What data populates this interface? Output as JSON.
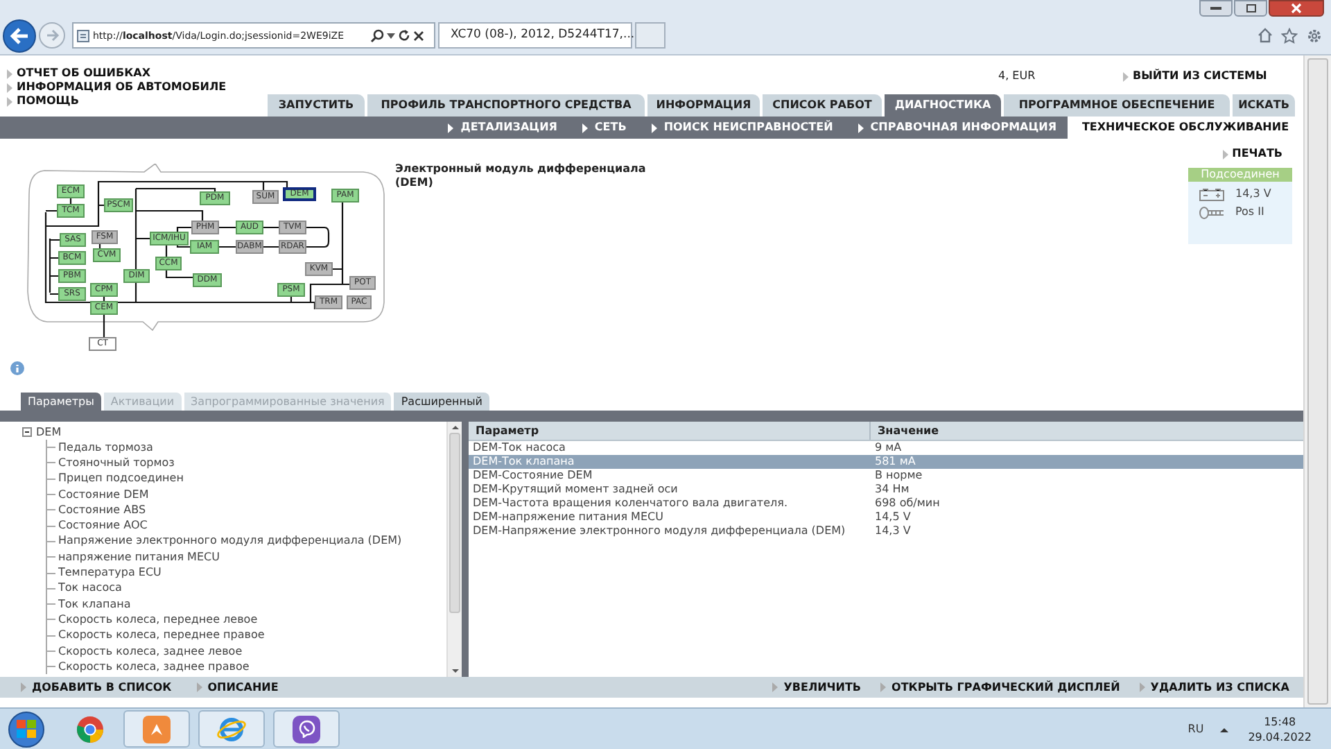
{
  "browser": {
    "url": "http://**localhost**/Vida/Login.do;jsessionid=2WE9iZE",
    "tabs": [
      {
        "title": "XC70 (08-), 2012, D5244T17,...",
        "selected": true
      }
    ]
  },
  "top_links": [
    "ОТЧЕТ ОБ ОШИБКАХ",
    "ИНФОРМАЦИЯ ОБ АВТОМОБИЛЕ",
    "ПОМОЩЬ"
  ],
  "account": {
    "info": "4, EUR",
    "logout": "ВЫЙТИ ИЗ СИСТЕМЫ"
  },
  "main_tabs": [
    {
      "label": "ЗАПУСТИТЬ",
      "selected": false
    },
    {
      "label": "ПРОФИЛЬ ТРАНСПОРТНОГО СРЕДСТВА",
      "selected": false
    },
    {
      "label": "ИНФОРМАЦИЯ",
      "selected": false
    },
    {
      "label": "СПИСОК РАБОТ",
      "selected": false
    },
    {
      "label": "ДИАГНОСТИКА",
      "selected": true
    },
    {
      "label": "ПРОГРАММНОЕ ОБЕСПЕЧЕНИЕ",
      "selected": false
    },
    {
      "label": "ИСКАТЬ",
      "selected": false
    }
  ],
  "sub_nav": [
    {
      "label": "ДЕТАЛИЗАЦИЯ",
      "selected": false
    },
    {
      "label": "СЕТЬ",
      "selected": false
    },
    {
      "label": "ПОИСК НЕИСПРАВНОСТЕЙ",
      "selected": false
    },
    {
      "label": "СПРАВОЧНАЯ ИНФОРМАЦИЯ",
      "selected": false
    },
    {
      "label": "ТЕХНИЧЕСКОЕ ОБСЛУЖИВАНИЕ",
      "selected": true
    }
  ],
  "diagram": {
    "nodes": [
      {
        "label": "ECM",
        "kind": "responding",
        "selected": false
      },
      {
        "label": "TCM",
        "kind": "responding",
        "selected": false
      },
      {
        "label": "PSCM",
        "kind": "responding",
        "selected": false
      },
      {
        "label": "PDM",
        "kind": "responding",
        "selected": false
      },
      {
        "label": "SUM",
        "kind": "not_responding",
        "selected": false
      },
      {
        "label": "DEM",
        "kind": "responding",
        "selected": true
      },
      {
        "label": "PAM",
        "kind": "responding",
        "selected": false
      },
      {
        "label": "FSM",
        "kind": "not_responding",
        "selected": false
      },
      {
        "label": "SAS",
        "kind": "responding",
        "selected": false
      },
      {
        "label": "CVM",
        "kind": "responding",
        "selected": false
      },
      {
        "label": "BCM",
        "kind": "responding",
        "selected": false
      },
      {
        "label": "PBM",
        "kind": "responding",
        "selected": false
      },
      {
        "label": "SRS",
        "kind": "responding",
        "selected": false
      },
      {
        "label": "CPM",
        "kind": "responding",
        "selected": false
      },
      {
        "label": "CEM",
        "kind": "responding",
        "selected": false
      },
      {
        "label": "DIM",
        "kind": "responding",
        "selected": false
      },
      {
        "label": "ICM/IHU",
        "kind": "responding",
        "selected": false
      },
      {
        "label": "PHM",
        "kind": "not_responding",
        "selected": false
      },
      {
        "label": "AUD",
        "kind": "responding",
        "selected": false
      },
      {
        "label": "TVM",
        "kind": "not_responding",
        "selected": false
      },
      {
        "label": "IAM",
        "kind": "responding",
        "selected": false
      },
      {
        "label": "DABM",
        "kind": "not_responding",
        "selected": false
      },
      {
        "label": "RDAR",
        "kind": "not_responding",
        "selected": false
      },
      {
        "label": "CCM",
        "kind": "responding",
        "selected": false
      },
      {
        "label": "DDM",
        "kind": "responding",
        "selected": false
      },
      {
        "label": "KVM",
        "kind": "not_responding",
        "selected": false
      },
      {
        "label": "POT",
        "kind": "not_responding",
        "selected": false
      },
      {
        "label": "PSM",
        "kind": "responding",
        "selected": false
      },
      {
        "label": "TRM",
        "kind": "not_responding",
        "selected": false
      },
      {
        "label": "PAC",
        "kind": "not_responding",
        "selected": false
      },
      {
        "label": "CT",
        "kind": "external",
        "selected": false
      }
    ]
  },
  "module_title": "Электронный модуль дифференциала (DEM)",
  "print": "ПЕЧАТЬ",
  "connection": {
    "status": "Подсоединен",
    "voltage": "14,3 V",
    "ignition": "Pos II"
  },
  "param_tabs": [
    {
      "label": "Параметры",
      "selected": true,
      "disabled": false
    },
    {
      "label": "Активации",
      "selected": false,
      "disabled": true
    },
    {
      "label": "Запрограммированные значения",
      "selected": false,
      "disabled": true
    },
    {
      "label": "Расширенный",
      "selected": false,
      "disabled": false
    }
  ],
  "tree": {
    "label": "DEM",
    "expanded": true,
    "children": [
      {
        "label": "Педаль тормоза"
      },
      {
        "label": "Стояночный тормоз"
      },
      {
        "label": "Прицеп подсоединен"
      },
      {
        "label": "Состояние DEM"
      },
      {
        "label": "Состояние ABS"
      },
      {
        "label": "Состояние AOC"
      },
      {
        "label": "Напряжение электронного модуля дифференциала (DEM)"
      },
      {
        "label": "напряжение питания MECU"
      },
      {
        "label": "Температура ECU"
      },
      {
        "label": "Ток насоса"
      },
      {
        "label": "Ток клапана"
      },
      {
        "label": "Скорость колеса, переднее левое"
      },
      {
        "label": "Скорость колеса, переднее правое"
      },
      {
        "label": "Скорость колеса, заднее левое"
      },
      {
        "label": "Скорость колеса, заднее правое"
      }
    ]
  },
  "table": {
    "columns": [
      "Параметр",
      "Значение"
    ],
    "rows": [
      {
        "cells": [
          "DEM-Ток насоса",
          "9 мА"
        ],
        "selected": false
      },
      {
        "cells": [
          "DEM-Ток клапана",
          "581 мА"
        ],
        "selected": true
      },
      {
        "cells": [
          "DEM-Состояние DEM",
          "В норме"
        ],
        "selected": false
      },
      {
        "cells": [
          "DEM-Крутящий момент задней оси",
          "34 Нм"
        ],
        "selected": false
      },
      {
        "cells": [
          "DEM-Частота вращения коленчатого вала двигателя.",
          "698 об/мин"
        ],
        "selected": false
      },
      {
        "cells": [
          "DEM-напряжение питания MECU",
          "14,5 V"
        ],
        "selected": false
      },
      {
        "cells": [
          "DEM-Напряжение электронного модуля дифференциала (DEM)",
          "14,3 V"
        ],
        "selected": false
      }
    ]
  },
  "left_actions": [
    "ДОБАВИТЬ В СПИСОК",
    "ОПИСАНИЕ"
  ],
  "right_actions": [
    "УВЕЛИЧИТЬ",
    "ОТКРЫТЬ ГРАФИЧЕСКИЙ ДИСПЛЕЙ",
    "УДАЛИТЬ ИЗ СПИСКА"
  ],
  "taskbar": {
    "language": "RU",
    "time": "15:48",
    "date": "29.04.2022"
  }
}
